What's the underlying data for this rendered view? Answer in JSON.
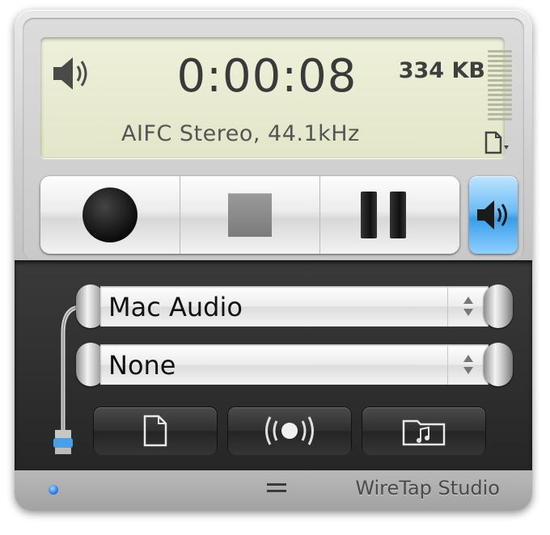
{
  "display": {
    "elapsed_time": "0:00:08",
    "file_size": "334 KB",
    "format": "AIFC Stereo, 44.1kHz",
    "speaker_icon": "speaker-icon",
    "document_menu_icon": "document-menu-icon"
  },
  "transport": {
    "record_icon": "record-icon",
    "stop_icon": "stop-icon",
    "pause_icon": "pause-icon",
    "monitor_icon": "speaker-icon"
  },
  "sources": {
    "primary": "Mac Audio",
    "secondary": "None"
  },
  "actions": [
    {
      "icon": "new-document-icon"
    },
    {
      "icon": "broadcast-icon"
    },
    {
      "icon": "music-folder-icon"
    }
  ],
  "status_bar": {
    "app_name": "WireTap Studio"
  },
  "colors": {
    "lcd_background": "#e9ebd2",
    "monitor_accent": "#4aa8f0",
    "status_led": "#2f86e8"
  }
}
